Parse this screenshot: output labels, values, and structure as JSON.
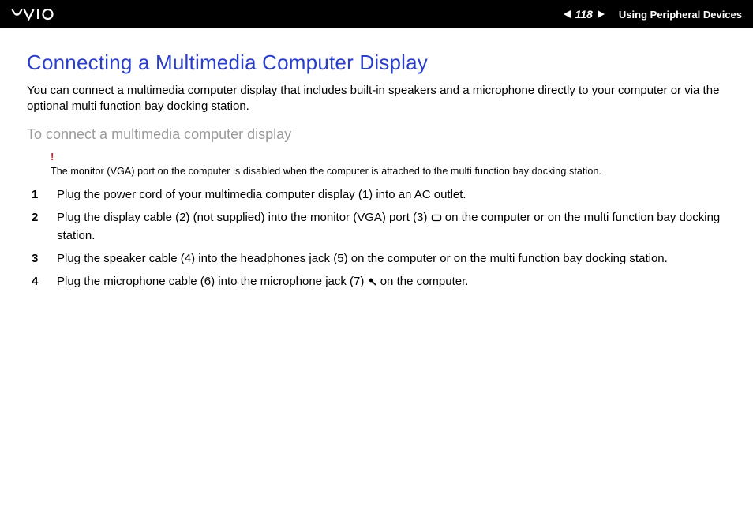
{
  "header": {
    "logo_alt": "VAIO",
    "page_number": "118",
    "section": "Using Peripheral Devices"
  },
  "body": {
    "title": "Connecting a Multimedia Computer Display",
    "intro": "You can connect a multimedia computer display that includes built-in speakers and a microphone directly to your computer or via the optional multi function bay docking station.",
    "subhead": "To connect a multimedia computer display",
    "warning": {
      "mark": "!",
      "text": "The monitor (VGA) port on the computer is disabled when the computer is attached to the multi function bay docking station."
    },
    "steps": [
      {
        "pre": "Plug the power cord of your multimedia computer display (1) into an AC outlet.",
        "icon": null,
        "post": ""
      },
      {
        "pre": "Plug the display cable (2) (not supplied) into the monitor (VGA) port (3) ",
        "icon": "vga-port-icon",
        "post": " on the computer or on the multi function bay docking station."
      },
      {
        "pre": "Plug the speaker cable (4) into the headphones jack (5) on the computer or on the multi function bay docking station.",
        "icon": null,
        "post": ""
      },
      {
        "pre": "Plug the microphone cable (6) into the microphone jack (7) ",
        "icon": "microphone-icon",
        "post": " on the computer."
      }
    ]
  }
}
